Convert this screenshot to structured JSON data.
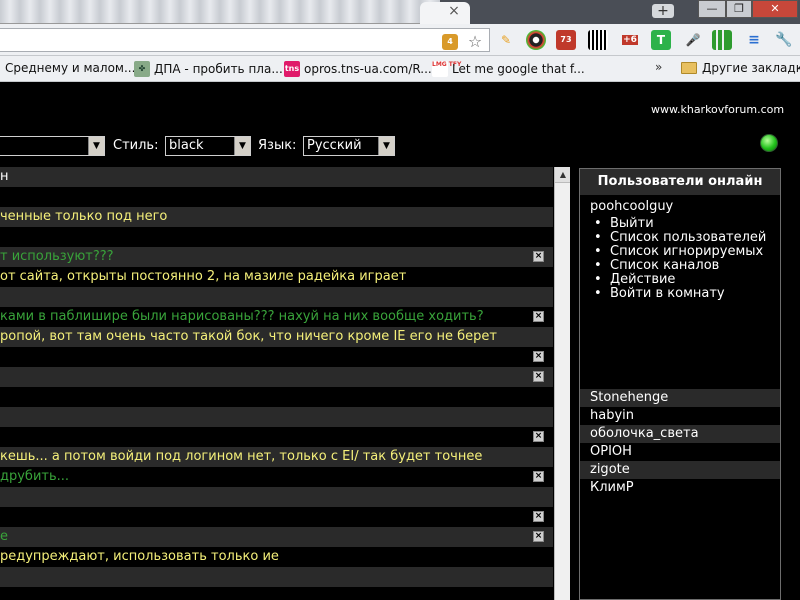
{
  "browser": {
    "tab_close": "×",
    "new_tab": "+",
    "window_buttons": {
      "minimize": "—",
      "maximize": "❐",
      "close": "✕"
    },
    "extension_badges": [
      "4",
      "73",
      "+6"
    ],
    "bookmarks": [
      {
        "label": "Среднему и малом...",
        "icon": "page-icon"
      },
      {
        "label": "ДПА - пробить пла...",
        "icon": "dpa-icon"
      },
      {
        "label": "opros.tns-ua.com/R...",
        "icon": "tns-icon"
      },
      {
        "label": "Let me google that f...",
        "icon": "lmgtfy-icon"
      }
    ],
    "bookmarks_overflow": "»",
    "other_bookmarks": "Другие закладки"
  },
  "page": {
    "site_url": "www.kharkovforum.com",
    "style_label": "Стиль:",
    "style_value": "black",
    "language_label": "Язык:",
    "language_value": "Русский",
    "room_select_value": ""
  },
  "messages": [
    {
      "text": "н",
      "color": "white",
      "bg": "alt",
      "x": false
    },
    {
      "text": "",
      "color": "white",
      "bg": "none",
      "x": false
    },
    {
      "text": "ченные только под него",
      "color": "yellow",
      "bg": "alt",
      "x": false
    },
    {
      "text": "",
      "color": "white",
      "bg": "none",
      "x": false
    },
    {
      "text": "т используют???",
      "color": "green",
      "bg": "alt",
      "x": true
    },
    {
      "text": "от сайта, открыты постоянно 2, на мазиле радейка играет",
      "color": "yellow",
      "bg": "none",
      "x": false
    },
    {
      "text": "",
      "color": "white",
      "bg": "alt",
      "x": false
    },
    {
      "text": "ками в паблишире были нарисованы??? нахуй на них вообще ходить?",
      "color": "green",
      "bg": "none",
      "x": true
    },
    {
      "text": "ропой, вот там очень часто такой бок, что ничего кроме IE его не берет",
      "color": "yellow",
      "bg": "alt",
      "x": false
    },
    {
      "text": "",
      "color": "white",
      "bg": "none",
      "x": true
    },
    {
      "text": "",
      "color": "white",
      "bg": "alt",
      "x": true
    },
    {
      "text": "",
      "color": "white",
      "bg": "none",
      "x": false
    },
    {
      "text": "",
      "color": "white",
      "bg": "alt",
      "x": false
    },
    {
      "text": "",
      "color": "white",
      "bg": "none",
      "x": true
    },
    {
      "text": "кешь... а потом войди под логином нет, только с EI/ так будет точнее",
      "color": "yellow",
      "bg": "alt",
      "x": false
    },
    {
      "text": "друбить...",
      "color": "green",
      "bg": "none",
      "x": true
    },
    {
      "text": "",
      "color": "white",
      "bg": "alt",
      "x": false
    },
    {
      "text": "",
      "color": "white",
      "bg": "none",
      "x": true
    },
    {
      "text": "е",
      "color": "green",
      "bg": "alt",
      "x": true
    },
    {
      "text": "редупреждают, использовать только ие",
      "color": "yellow",
      "bg": "none",
      "x": false
    },
    {
      "text": "",
      "color": "white",
      "bg": "alt",
      "x": false
    }
  ],
  "online": {
    "title": "Пользователи онлайн",
    "current_user": "poohcoolguy",
    "menu": [
      "Выйти",
      "Список пользователей",
      "Список игнорируемых",
      "Список каналов",
      "Действие",
      "Войти в комнату"
    ],
    "users": [
      "Stonehenge",
      "habyin",
      "оболочка_света",
      "OPIOH",
      "zigote",
      "КлимР"
    ]
  }
}
